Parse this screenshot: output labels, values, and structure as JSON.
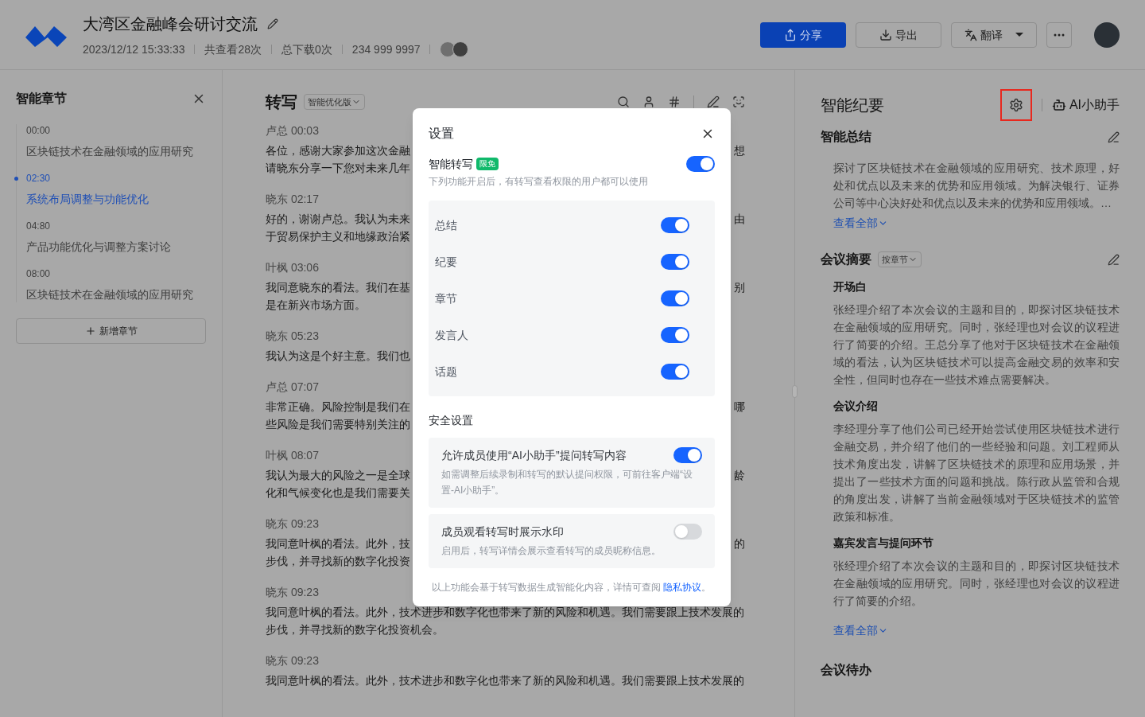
{
  "header": {
    "title": "大湾区金融峰会研讨交流",
    "meta": [
      "2023/12/12 15:33:33",
      "共查看28次",
      "总下载0次",
      "234 999 9997"
    ],
    "buttons": [
      {
        "kind": "share",
        "label": "分享"
      },
      {
        "kind": "export",
        "label": "导出"
      },
      {
        "kind": "translate",
        "label": "翻译"
      },
      {
        "kind": "more"
      }
    ]
  },
  "chapters": {
    "title": "智能章节",
    "items": [
      {
        "time": "00:00",
        "title": "区块链技术在金融领域的应用研究",
        "selected": false
      },
      {
        "time": "02:30",
        "title": "系统布局调整与功能优化",
        "selected": true
      },
      {
        "time": "04:80",
        "title": "产品功能优化与调整方案讨论",
        "selected": false
      },
      {
        "time": "08:00",
        "title": "区块链技术在金融领域的应用研究",
        "selected": false
      }
    ],
    "add_button": "新增章节"
  },
  "transcript": {
    "title": "转写",
    "version": "智能优化版",
    "entries": [
      {
        "speaker": "卢总 00:03",
        "lines": [
          {
            "text": "各位，感谢大家参加这次金融",
            "end": "想"
          },
          {
            "text": "请晓东分享一下您对未来几年"
          }
        ]
      },
      {
        "speaker": "晓东 02:17",
        "lines": [
          {
            "text": "好的，谢谢卢总。我认为未来",
            "end": "由"
          },
          {
            "text": "于贸易保护主义和地缘政治紧"
          }
        ]
      },
      {
        "speaker": "叶枫 03:06",
        "lines": [
          {
            "text": "我同意晓东的看法。我们在基",
            "end": "别"
          },
          {
            "text": "是在新兴市场方面。"
          }
        ]
      },
      {
        "speaker": "晓东 05:23",
        "lines": [
          {
            "text": "我认为这是个好主意。我们也"
          }
        ]
      },
      {
        "speaker": "卢总 07:07",
        "lines": [
          {
            "text": "非常正确。风险控制是我们在",
            "end": "哪"
          },
          {
            "text": "些风险是我们需要特别关注的"
          }
        ]
      },
      {
        "speaker": "叶枫 08:07",
        "lines": [
          {
            "text": "我认为最大的风险之一是全球",
            "end": "龄"
          },
          {
            "text": "化和气候变化也是我们需要关"
          }
        ]
      },
      {
        "speaker": "晓东 09:23",
        "lines": [
          {
            "text": "我同意叶枫的看法。此外，技",
            "end": "的"
          },
          {
            "text": "步伐，并寻找新的数字化投资"
          }
        ]
      },
      {
        "speaker": "晓东 09:23",
        "lines": [
          {
            "text": "我同意叶枫的看法。此外，技术进步和数字化也带来了新的风险和机遇。我们需要跟上技术发展的"
          },
          {
            "text": "步伐，并寻找新的数字化投资机会。"
          }
        ]
      },
      {
        "speaker": "晓东 09:23",
        "lines": [
          {
            "text": "我同意叶枫的看法。此外，技术进步和数字化也带来了新的风险和机遇。我们需要跟上技术发展的"
          }
        ]
      }
    ]
  },
  "minutes": {
    "title": "智能纪要",
    "assistant": "AI小助手",
    "summary": {
      "heading": "智能总结",
      "text": "探讨了区块链技术在金融领域的应用研究、技术原理，好处和优点以及未来的优势和应用领域。为解决银行、证券公司等中心决好处和优点以及未来的优势和应用领域。…",
      "more": "查看全部"
    },
    "abstract": {
      "heading": "会议摘要",
      "filter": "按章节",
      "items": [
        {
          "title": "开场白",
          "text": "张经理介绍了本次会议的主题和目的，即探讨区块链技术在金融领域的应用研究。同时，张经理也对会议的议程进行了简要的介绍。王总分享了他对于区块链技术在金融领域的看法，认为区块链技术可以提高金融交易的效率和安全性，但同时也存在一些技术难点需要解决。"
        },
        {
          "title": "会议介绍",
          "text": "李经理分享了他们公司已经开始尝试使用区块链技术进行金融交易，并介绍了他们的一些经验和问题。刘工程师从技术角度出发，讲解了区块链技术的原理和应用场景，并提出了一些技术方面的问题和挑战。陈行政从监管和合规的角度出发，讲解了当前金融领域对于区块链技术的监管政策和标准。"
        },
        {
          "title": "嘉宾发言与提问环节",
          "text": "张经理介绍了本次会议的主题和目的，即探讨区块链技术在金融领域的应用研究。同时，张经理也对会议的议程进行了简要的介绍。"
        }
      ],
      "more": "查看全部"
    },
    "todo": {
      "heading": "会议待办"
    }
  },
  "settings_dialog": {
    "title": "设置",
    "smart": {
      "label": "智能转写",
      "badge": "限免",
      "on": true,
      "hint": "下列功能开启后，有转写查看权限的用户都可以使用",
      "features": [
        {
          "label": "总结",
          "on": true
        },
        {
          "label": "纪要",
          "on": true
        },
        {
          "label": "章节",
          "on": true
        },
        {
          "label": "发言人",
          "on": true
        },
        {
          "label": "话题",
          "on": true
        }
      ]
    },
    "security": {
      "heading": "安全设置",
      "options": [
        {
          "label": "允许成员使用“AI小助手”提问转写内容",
          "hint": "如需调整后续录制和转写的默认提问权限，可前往客户端“设置-AI小助手”。",
          "on": true
        },
        {
          "label": "成员观看转写时展示水印",
          "hint": "启用后，转写详情会展示查看转写的成员昵称信息。",
          "on": false
        }
      ]
    },
    "footer": {
      "text": "以上功能会基于转写数据生成智能化内容，详情可查阅 ",
      "link": "隐私协议",
      "end": "。"
    }
  }
}
